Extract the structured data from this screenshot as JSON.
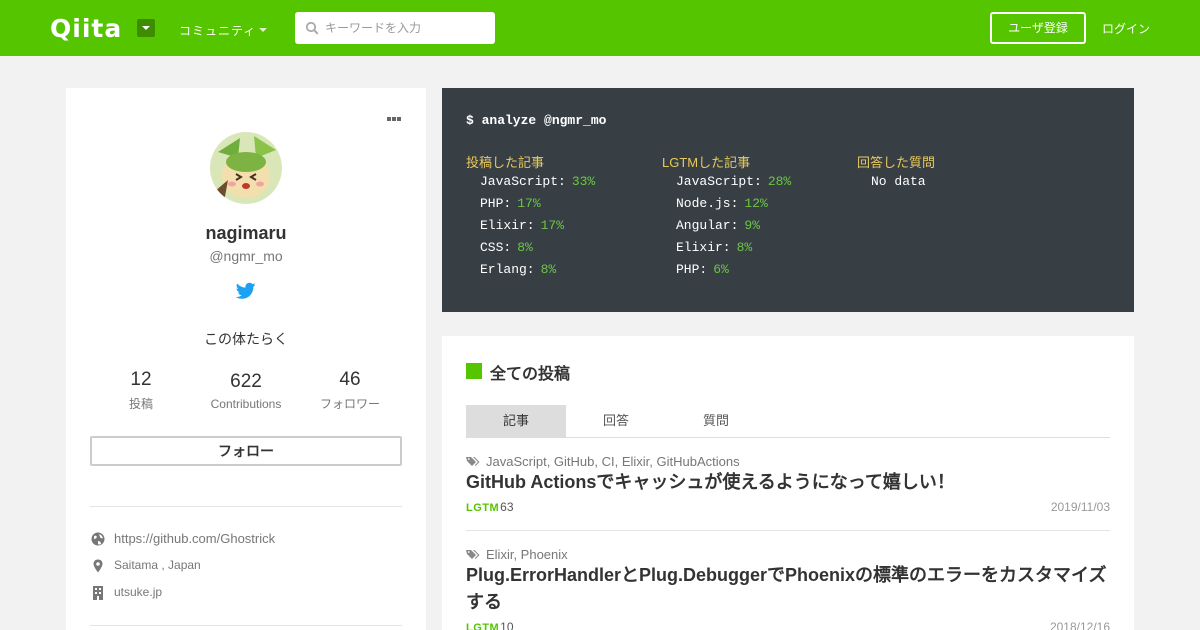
{
  "header": {
    "logo": "Qiita",
    "community": "コミュニティ",
    "search_placeholder": "キーワードを入力",
    "signup": "ユーザ登録",
    "login": "ログイン",
    "brand_color": "#55c500"
  },
  "profile": {
    "name": "nagimaru",
    "handle": "@ngmr_mo",
    "bio": "この体たらく",
    "stats": [
      {
        "value": "12",
        "label": "投稿"
      },
      {
        "value": "622",
        "label": "Contributions"
      },
      {
        "value": "46",
        "label": "フォロワー"
      }
    ],
    "follow": "フォロー",
    "github": "https://github.com/Ghostrick",
    "location": "Saitama , Japan",
    "organization": "utsuke.jp"
  },
  "terminal": {
    "command": "$ analyze @ngmr_mo",
    "columns": [
      {
        "heading": "投稿した記事",
        "rows": [
          {
            "name": "JavaScript:",
            "pct": "33%"
          },
          {
            "name": "PHP:",
            "pct": "17%"
          },
          {
            "name": "Elixir:",
            "pct": "17%"
          },
          {
            "name": "CSS:",
            "pct": "8%"
          },
          {
            "name": "Erlang:",
            "pct": "8%"
          }
        ]
      },
      {
        "heading": "LGTMした記事",
        "rows": [
          {
            "name": "JavaScript:",
            "pct": "28%"
          },
          {
            "name": "Node.js:",
            "pct": "12%"
          },
          {
            "name": "Angular:",
            "pct": "9%"
          },
          {
            "name": "Elixir:",
            "pct": "8%"
          },
          {
            "name": "PHP:",
            "pct": "6%"
          }
        ]
      },
      {
        "heading": "回答した質問",
        "nodata": "No data"
      }
    ]
  },
  "posts": {
    "title": "全ての投稿",
    "tabs": [
      "記事",
      "回答",
      "質問"
    ],
    "lgtm_label": "LGTM",
    "items": [
      {
        "tags": "JavaScript, GitHub, CI, Elixir, GitHubActions",
        "title": "GitHub Actionsでキャッシュが使えるようになって嬉しい！",
        "lgtm": "63",
        "date": "2019/11/03"
      },
      {
        "tags": "Elixir, Phoenix",
        "title": "Plug.ErrorHandlerとPlug.DebuggerでPhoenixの標準のエラーをカスタマイズする",
        "lgtm": "10",
        "date": "2018/12/16"
      }
    ]
  }
}
